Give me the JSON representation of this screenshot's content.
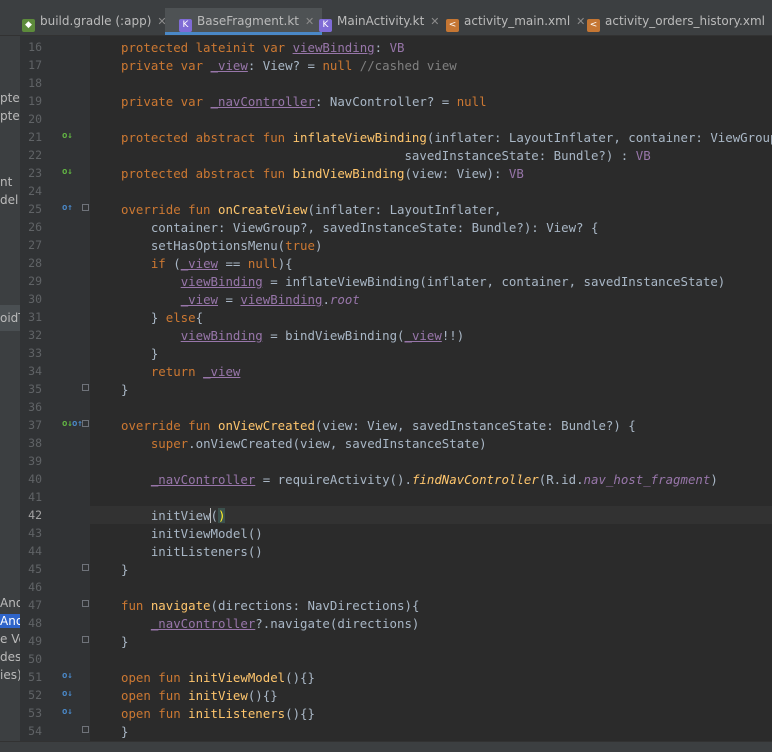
{
  "tabs": [
    {
      "label": "build.gradle (:app)",
      "active": false,
      "icon": "gradle-icon"
    },
    {
      "label": "BaseFragment.kt",
      "active": true,
      "icon": "kotlin-icon"
    },
    {
      "label": "MainActivity.kt",
      "active": false,
      "icon": "kotlin-icon"
    },
    {
      "label": "activity_main.xml",
      "active": false,
      "icon": "xml-icon"
    },
    {
      "label": "activity_orders_history.xml",
      "active": false,
      "icon": "xml-icon"
    }
  ],
  "left_panel": [
    "pter",
    "pter",
    "nt",
    "del",
    "oidT",
    "And",
    "And",
    "e Ve",
    "des",
    "ies)"
  ],
  "lines": [
    {
      "n": "16",
      "tokens": [
        [
          "protected lateinit var ",
          "kw"
        ],
        [
          "viewBinding",
          "prop u"
        ],
        [
          ": ",
          ""
        ],
        [
          "VB",
          "prop"
        ]
      ]
    },
    {
      "n": "17",
      "tokens": [
        [
          "private var ",
          "kw"
        ],
        [
          "_view",
          "prop u"
        ],
        [
          ": View? = ",
          ""
        ],
        [
          "null",
          "kw"
        ],
        [
          " //cashed view",
          "cm"
        ]
      ]
    },
    {
      "n": "18",
      "tokens": []
    },
    {
      "n": "19",
      "tokens": [
        [
          "private var ",
          "kw"
        ],
        [
          "_navController",
          "prop u"
        ],
        [
          ": NavController? = ",
          ""
        ],
        [
          "null",
          "kw"
        ]
      ]
    },
    {
      "n": "20",
      "tokens": []
    },
    {
      "n": "21",
      "tokens": [
        [
          "protected abstract fun ",
          "kw"
        ],
        [
          "inflateViewBinding",
          "fn"
        ],
        [
          "(inflater: LayoutInflater, container: ViewGroup?,",
          ""
        ]
      ]
    },
    {
      "n": "22",
      "tokens": [
        [
          "                                      savedInstanceState: Bundle?) : ",
          ""
        ],
        [
          "VB",
          "prop"
        ]
      ]
    },
    {
      "n": "23",
      "tokens": [
        [
          "protected abstract fun ",
          "kw"
        ],
        [
          "bindViewBinding",
          "fn"
        ],
        [
          "(view: View): ",
          ""
        ],
        [
          "VB",
          "prop"
        ]
      ]
    },
    {
      "n": "24",
      "tokens": []
    },
    {
      "n": "25",
      "tokens": [
        [
          "override fun ",
          "kw"
        ],
        [
          "onCreateView",
          "fn"
        ],
        [
          "(inflater: LayoutInflater,",
          ""
        ]
      ]
    },
    {
      "n": "26",
      "tokens": [
        [
          "    container: ViewGroup?, savedInstanceState: Bundle?): View? {",
          ""
        ]
      ]
    },
    {
      "n": "27",
      "tokens": [
        [
          "    setHasOptionsMenu(",
          ""
        ],
        [
          "true",
          "kw"
        ],
        [
          ")",
          ""
        ]
      ]
    },
    {
      "n": "28",
      "tokens": [
        [
          "    ",
          ""
        ],
        [
          "if ",
          "kw"
        ],
        [
          "(",
          ""
        ],
        [
          "_view",
          "prop u"
        ],
        [
          " == ",
          ""
        ],
        [
          "null",
          "kw"
        ],
        [
          "){",
          ""
        ]
      ]
    },
    {
      "n": "29",
      "tokens": [
        [
          "        ",
          ""
        ],
        [
          "viewBinding",
          "prop u"
        ],
        [
          " = inflateViewBinding(inflater, container, savedInstanceState)",
          ""
        ]
      ]
    },
    {
      "n": "30",
      "tokens": [
        [
          "        ",
          ""
        ],
        [
          "_view",
          "prop u"
        ],
        [
          " = ",
          ""
        ],
        [
          "viewBinding",
          "prop u"
        ],
        [
          ".",
          ""
        ],
        [
          "root",
          "prop it"
        ]
      ]
    },
    {
      "n": "31",
      "tokens": [
        [
          "    } ",
          ""
        ],
        [
          "else",
          "kw"
        ],
        [
          "{",
          ""
        ]
      ]
    },
    {
      "n": "32",
      "tokens": [
        [
          "        ",
          ""
        ],
        [
          "viewBinding",
          "prop u"
        ],
        [
          " = bindViewBinding(",
          ""
        ],
        [
          "_view",
          "prop u"
        ],
        [
          "!!)",
          ""
        ]
      ]
    },
    {
      "n": "33",
      "tokens": [
        [
          "    }",
          ""
        ]
      ]
    },
    {
      "n": "34",
      "tokens": [
        [
          "    ",
          ""
        ],
        [
          "return ",
          "kw"
        ],
        [
          "_view",
          "prop u"
        ]
      ]
    },
    {
      "n": "35",
      "tokens": [
        [
          "}",
          ""
        ]
      ]
    },
    {
      "n": "36",
      "tokens": []
    },
    {
      "n": "37",
      "tokens": [
        [
          "override fun ",
          "kw"
        ],
        [
          "onViewCreated",
          "fn"
        ],
        [
          "(view: View, savedInstanceState: Bundle?) {",
          ""
        ]
      ]
    },
    {
      "n": "38",
      "tokens": [
        [
          "    ",
          ""
        ],
        [
          "super",
          "kw"
        ],
        [
          ".onViewCreated(view, savedInstanceState)",
          ""
        ]
      ]
    },
    {
      "n": "39",
      "tokens": []
    },
    {
      "n": "40",
      "tokens": [
        [
          "    ",
          ""
        ],
        [
          "_navController",
          "prop u"
        ],
        [
          " = requireActivity().",
          ""
        ],
        [
          "findNavController",
          "fn it"
        ],
        [
          "(R.id.",
          ""
        ],
        [
          "nav_host_fragment",
          "prop it"
        ],
        [
          ")",
          ""
        ]
      ]
    },
    {
      "n": "41",
      "tokens": []
    },
    {
      "n": "42",
      "tokens": [
        [
          "    initView",
          ""
        ],
        [
          "(",
          ""
        ],
        [
          ")",
          "bracehl"
        ]
      ]
    },
    {
      "n": "43",
      "tokens": [
        [
          "    initViewModel()",
          ""
        ]
      ]
    },
    {
      "n": "44",
      "tokens": [
        [
          "    initListeners()",
          ""
        ]
      ]
    },
    {
      "n": "45",
      "tokens": [
        [
          "}",
          ""
        ]
      ]
    },
    {
      "n": "46",
      "tokens": []
    },
    {
      "n": "47",
      "tokens": [
        [
          "fun ",
          "kw"
        ],
        [
          "navigate",
          "fn"
        ],
        [
          "(directions: NavDirections){",
          ""
        ]
      ]
    },
    {
      "n": "48",
      "tokens": [
        [
          "    ",
          ""
        ],
        [
          "_navController",
          "prop u"
        ],
        [
          "?.navigate(directions)",
          ""
        ]
      ]
    },
    {
      "n": "49",
      "tokens": [
        [
          "}",
          ""
        ]
      ]
    },
    {
      "n": "50",
      "tokens": []
    },
    {
      "n": "51",
      "tokens": [
        [
          "open fun ",
          "kw"
        ],
        [
          "initViewModel",
          "fn"
        ],
        [
          "(){}",
          ""
        ]
      ]
    },
    {
      "n": "52",
      "tokens": [
        [
          "open fun ",
          "kw"
        ],
        [
          "initView",
          "fn"
        ],
        [
          "(){}",
          ""
        ]
      ]
    },
    {
      "n": "53",
      "tokens": [
        [
          "open fun ",
          "kw"
        ],
        [
          "initListeners",
          "fn"
        ],
        [
          "(){}",
          ""
        ]
      ]
    },
    {
      "n": "54",
      "tokens": [
        [
          "}",
          ""
        ]
      ]
    }
  ],
  "gutter_icons": [
    {
      "line": "21",
      "type": "implemented-down",
      "color": "#62b543"
    },
    {
      "line": "23",
      "type": "implemented-down",
      "color": "#62b543"
    },
    {
      "line": "25",
      "type": "overrides-up",
      "color": "#4a88c7"
    },
    {
      "line": "37",
      "type": "implemented-down",
      "color": "#62b543"
    },
    {
      "line": "37",
      "type": "overrides-up",
      "color": "#4a88c7"
    },
    {
      "line": "51",
      "type": "implemented-down",
      "color": "#4a88c7"
    },
    {
      "line": "52",
      "type": "implemented-down",
      "color": "#4a88c7"
    },
    {
      "line": "53",
      "type": "implemented-down",
      "color": "#4a88c7"
    }
  ],
  "current_line": "42",
  "colors": {
    "keyword": "#cc7832",
    "function": "#ffc66d",
    "property": "#9876aa",
    "comment": "#808080",
    "text": "#a9b7c6",
    "background": "#2b2b2b"
  }
}
